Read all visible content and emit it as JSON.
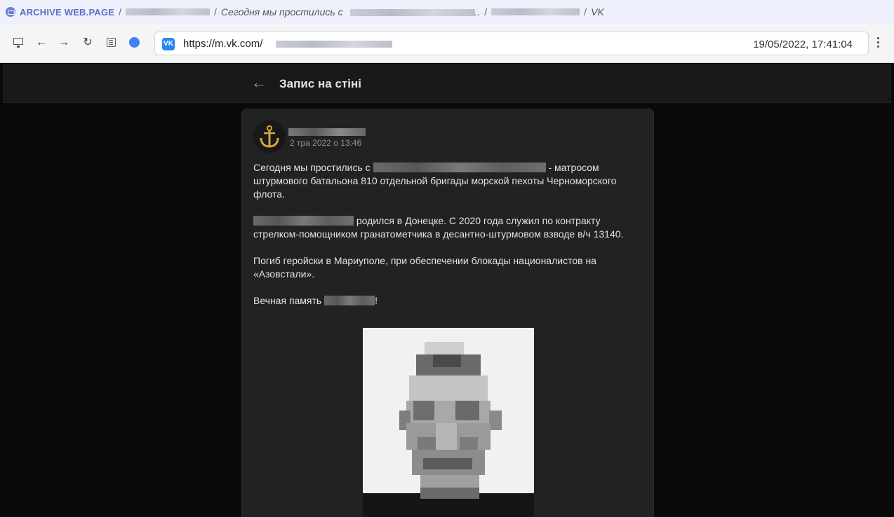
{
  "archive_bar": {
    "brand": "ARCHIVE WEB.PAGE",
    "separator": "/",
    "post_title_prefix": "Сегодня мы простились с",
    "post_title_suffix": "..",
    "site_name": "VK"
  },
  "browser": {
    "url_prefix": "https://m.vk.com/",
    "capture_timestamp": "19/05/2022, 17:41:04",
    "icons": [
      "monitor-icon",
      "arrow-left-icon",
      "arrow-right-icon",
      "reload-icon",
      "reader-icon",
      "status-dot-icon",
      "vk-logo-icon",
      "kebab-menu-icon"
    ]
  },
  "vk_header": {
    "back_label": "←",
    "title": "Запис на стіні"
  },
  "post": {
    "date": "2 тра 2022 о 13:46",
    "p1_before": "Сегодня мы простились с",
    "p1_after": " - матросом штурмового батальона 810 отдельной бригады морской пехоты Черноморского флота.",
    "p2_after": " родился в Донецке. С 2020 года служил по контракту стрелком-помощником гранатометчика в десантно-штурмовом взводе в/ч 13140.",
    "p3": "Погиб геройски в Мариуполе, при обеспечении блокады националистов на «Азовстали».",
    "p4_before": "Вечная память",
    "p4_after": "!"
  },
  "colors": {
    "archive_brand": "#5b6fc8",
    "vk_blue": "#2787f5",
    "back_arrow": "#71aaeb",
    "card_bg": "#222222",
    "page_bg": "#0a0a0a"
  }
}
